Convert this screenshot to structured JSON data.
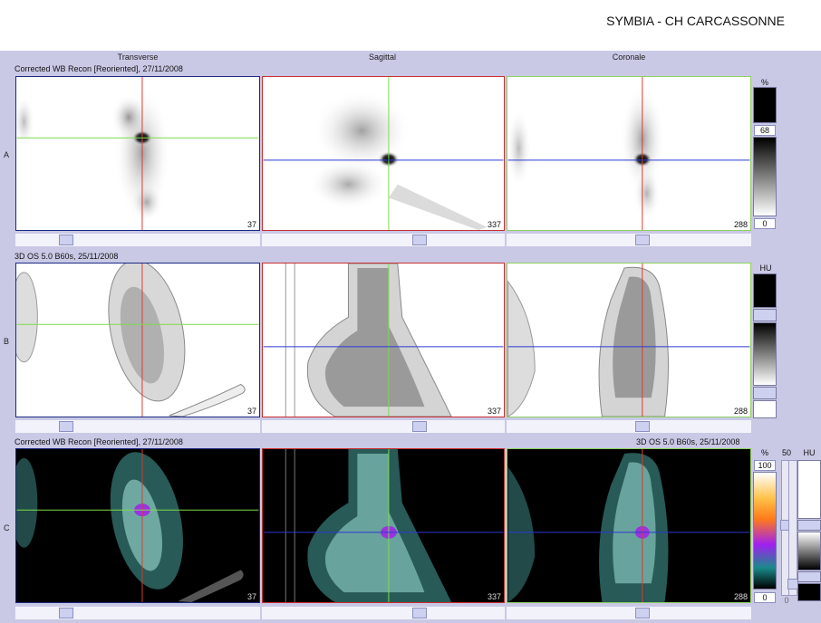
{
  "header": {
    "title": "SYMBIA - CH CARCASSONNE"
  },
  "columns": [
    "Transverse",
    "Sagittal",
    "Coronale"
  ],
  "rows": [
    {
      "letter": "A",
      "caption_left": "Corrected WB Recon [Reoriented], 27/11/2008",
      "caption_right": ""
    },
    {
      "letter": "B",
      "caption_left": "3D  OS  5.0  B60s, 25/11/2008",
      "caption_right": ""
    },
    {
      "letter": "C",
      "caption_left": "Corrected WB Recon [Reoriented], 27/11/2008",
      "caption_right": "3D  OS  5.0  B60s, 25/11/2008"
    }
  ],
  "slice_numbers": [
    "37",
    "337",
    "288"
  ],
  "scales": {
    "a": {
      "unit": "%",
      "top_value": "68",
      "bottom_value": "0"
    },
    "b": {
      "unit": "HU"
    },
    "c": {
      "unit": "%",
      "top_value": "100",
      "bottom_value": "0",
      "side_value": "50",
      "side_bottom": "0",
      "unit_right": "HU"
    }
  },
  "colors": {
    "crosshair_red": "#e23a2a",
    "crosshair_green": "#7ddc4a",
    "crosshair_blue": "#2a3ad0",
    "border_transverse": "#1a2a80",
    "border_sagittal": "#c83030",
    "border_coronal": "#8ed060"
  }
}
